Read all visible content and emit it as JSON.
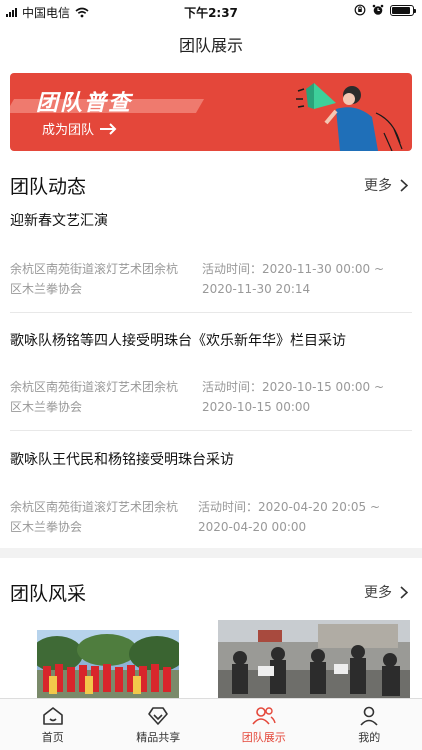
{
  "status": {
    "carrier": "中国电信",
    "time": "下午2:37",
    "battery_level": 0.9
  },
  "nav": {
    "title": "团队展示"
  },
  "banner": {
    "headline": "团队普查",
    "cta": "成为团队"
  },
  "team_news": {
    "title": "团队动态",
    "more_label": "更多",
    "items": [
      {
        "title": "迎新春文艺汇演",
        "org": "余杭区南苑街道滚灯艺术团余杭区木兰拳协会",
        "time": "活动时间：2020-11-30 00:00 ~ 2020-11-30 20:14"
      },
      {
        "title": "歌咏队杨铭等四人接受明珠台《欢乐新年华》栏目采访",
        "org": "余杭区南苑街道滚灯艺术团余杭区木兰拳协会",
        "time": "活动时间：2020-10-15 00:00 ~ 2020-10-15 00:00"
      },
      {
        "title": "歌咏队王代民和杨铭接受明珠台采访",
        "org": "余杭区南苑街道滚灯艺术团余杭区木兰拳协会",
        "time": "活动时间：2020-04-20 20:05 ~ 2020-04-20 00:00"
      }
    ]
  },
  "team_style": {
    "title": "团队风采",
    "more_label": "更多"
  },
  "tabs": [
    {
      "label": "首页",
      "icon": "home-icon",
      "active": false
    },
    {
      "label": "精品共享",
      "icon": "share-icon",
      "active": false
    },
    {
      "label": "团队展示",
      "icon": "team-icon",
      "active": true
    },
    {
      "label": "我的",
      "icon": "user-icon",
      "active": false
    }
  ],
  "colors": {
    "accent": "#e4473a"
  }
}
